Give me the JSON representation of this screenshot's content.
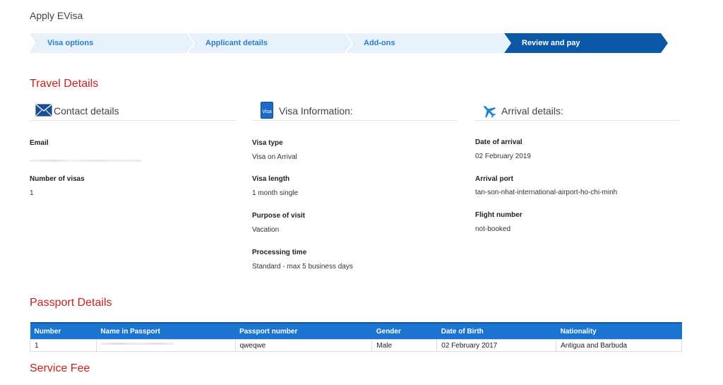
{
  "page": {
    "title": "Apply EVisa"
  },
  "stepper": {
    "steps": [
      {
        "label": "Visa options",
        "active": false
      },
      {
        "label": "Applicant details",
        "active": false
      },
      {
        "label": "Add-ons",
        "active": false
      },
      {
        "label": "Review and pay",
        "active": true
      }
    ],
    "colors": {
      "inactive_fill": "#e6f1fb",
      "active_fill": "#0b58a8"
    }
  },
  "travel": {
    "heading": "Travel Details",
    "contact": {
      "title": "Contact details",
      "icon": "envelope-icon",
      "email_label": "Email",
      "email_value": "",
      "num_visas_label": "Number of visas",
      "num_visas_value": "1"
    },
    "visa": {
      "title": "Visa Information:",
      "icon": "visa-card-icon",
      "icon_text": "Visa",
      "type_label": "Visa type",
      "type_value": "Visa on Arrival",
      "length_label": "Visa length",
      "length_value": "1 month single",
      "purpose_label": "Purpose of visit",
      "purpose_value": "Vacation",
      "processing_label": "Processing time",
      "processing_value": "Standard - max 5 business days"
    },
    "arrival": {
      "title": "Arrival details:",
      "icon": "airplane-icon",
      "date_label": "Date of arrival",
      "date_value": "02 February 2019",
      "port_label": "Arrival port",
      "port_value": "tan-son-nhat-international-airport-ho-chi-minh",
      "flight_label": "Flight number",
      "flight_value": "not-booked"
    }
  },
  "passport": {
    "heading": "Passport Details",
    "columns": [
      "Number",
      "Name in Passport",
      "Passport number",
      "Gender",
      "Date of Birth",
      "Nationality"
    ],
    "rows": [
      {
        "number": "1",
        "name": "",
        "passport_number": "qweqwe",
        "gender": "Male",
        "dob": "02 February 2017",
        "nationality": "Antigua and Barbuda"
      }
    ]
  },
  "service_fee": {
    "heading": "Service Fee"
  },
  "colors": {
    "accent_red": "#c8201c",
    "link_blue": "#2a7fc6",
    "table_header": "#1c74d1"
  }
}
